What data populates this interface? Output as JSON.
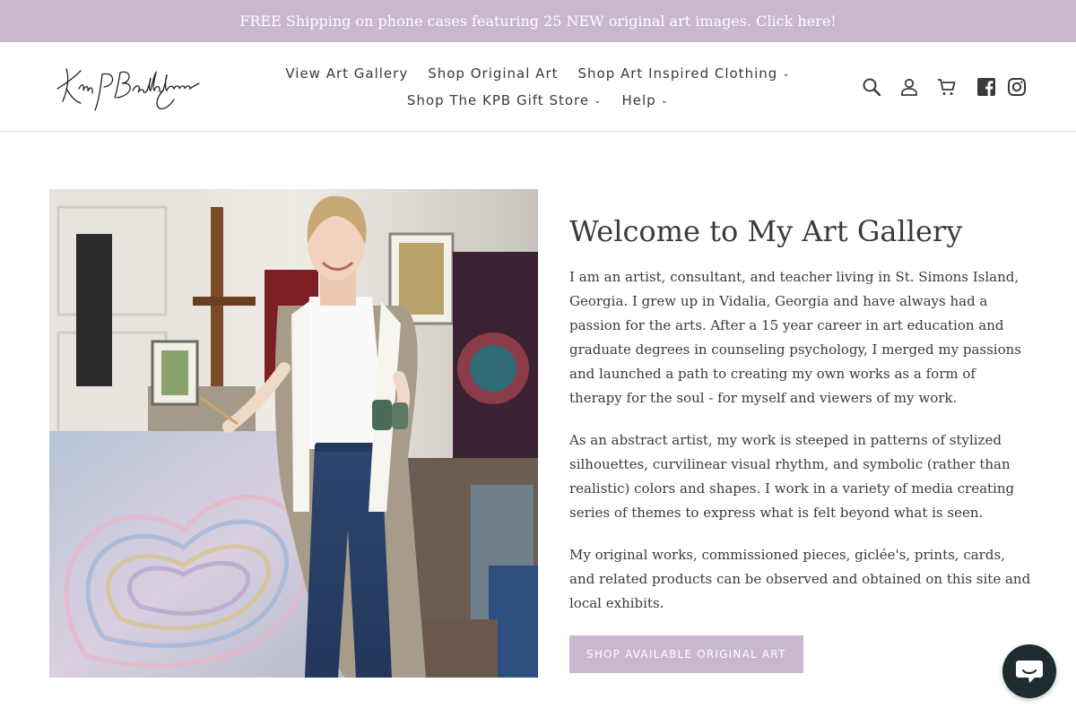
{
  "announcement": {
    "text": "FREE Shipping on phone cases featuring 25 NEW original art images. Click here!"
  },
  "brand": {
    "logo_alt": "Kim P Bartholomew signature logo",
    "text": "Kim P Bartholomew"
  },
  "nav": {
    "items": [
      {
        "label": "View Art Gallery",
        "dropdown": false
      },
      {
        "label": "Shop Original Art",
        "dropdown": false
      },
      {
        "label": "Shop Art Inspired Clothing",
        "dropdown": true
      },
      {
        "label": "Shop The KPB Gift Store",
        "dropdown": true
      },
      {
        "label": "Help",
        "dropdown": true
      }
    ]
  },
  "header_icons": [
    "search-icon",
    "account-icon",
    "cart-icon",
    "facebook-icon",
    "instagram-icon"
  ],
  "hero": {
    "image_alt": "Artist standing beside a large pastel heart painting in her studio",
    "title": "Welcome to My Art Gallery",
    "paragraphs": [
      "I am an artist, consultant, and teacher living in St. Simons Island, Georgia. I grew up in Vidalia, Georgia and have always had a passion for the arts. After a 15 year career in art education and graduate degrees in counseling psychology, I merged my passions and launched a path to creating my own works as a form of therapy for the soul - for myself and viewers of my work.",
      "As an abstract artist, my work is steeped in patterns of stylized silhouettes, curvilinear visual rhythm, and symbolic (rather than realistic) colors and shapes. I work in a variety of media creating series of themes to express what is felt beyond what is seen.",
      "My original works, commissioned pieces, giclée's, prints, cards, and related products can be observed and obtained on this site and local exhibits."
    ],
    "cta_label": "Shop available original art"
  },
  "colors": {
    "accent": "#c9b6cf",
    "text": "#3a3a3a",
    "chat_bg": "#1e2b30"
  },
  "chat": {
    "icon": "chat-bubble-icon"
  }
}
